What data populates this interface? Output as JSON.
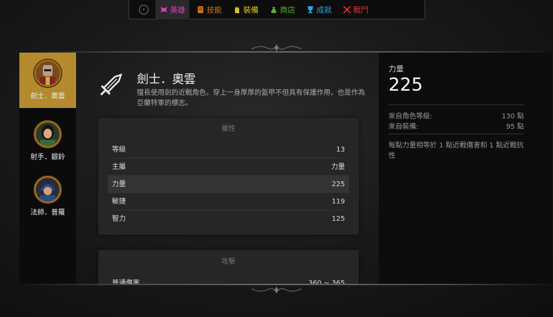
{
  "nav": {
    "back_icon": "chevron-left-icon",
    "items": [
      {
        "label": "英雄",
        "icon": "hero-icon",
        "color": "#e040c0",
        "active": true
      },
      {
        "label": "技能",
        "icon": "scroll-icon",
        "color": "#c8781e"
      },
      {
        "label": "裝備",
        "icon": "glove-icon",
        "color": "#d8c820"
      },
      {
        "label": "商店",
        "icon": "bag-icon",
        "color": "#5cb030"
      },
      {
        "label": "成就",
        "icon": "trophy-icon",
        "color": "#2aa8d8"
      },
      {
        "label": "戰鬥",
        "icon": "crossed-swords-icon",
        "color": "#d83030"
      }
    ]
  },
  "heroes": [
    {
      "name": "劍士．奧雲",
      "avatar": "swordsman-avatar",
      "active": true
    },
    {
      "name": "射手．銀鈴",
      "avatar": "archer-avatar"
    },
    {
      "name": "法師．普羅",
      "avatar": "mage-avatar"
    }
  ],
  "main": {
    "icon": "sword-icon",
    "title": "劍士．奧雲",
    "description": "擅長使用劍的近戰角色，穿上一身厚厚的盔甲不但具有保護作用，也是作為亞蘭特軍的標志。"
  },
  "attributes": {
    "title": "屬性",
    "rows": [
      {
        "label": "等級",
        "value": "13"
      },
      {
        "label": "主屬",
        "value": "力量"
      },
      {
        "label": "力量",
        "value": "225",
        "selected": true
      },
      {
        "label": "敏捷",
        "value": "119"
      },
      {
        "label": "智力",
        "value": "125"
      }
    ]
  },
  "attack": {
    "title": "攻擊",
    "rows": [
      {
        "label": "普通傷害",
        "value": "360 ~ 365"
      }
    ]
  },
  "detail": {
    "name": "力量",
    "value": "225",
    "sources": [
      {
        "label": "來自角色等級:",
        "value": "130 點"
      },
      {
        "label": "來自裝備:",
        "value": "95 點"
      }
    ],
    "note": "每點力量相等於 1 點近戰傷害和 1 點近戰抗性"
  }
}
